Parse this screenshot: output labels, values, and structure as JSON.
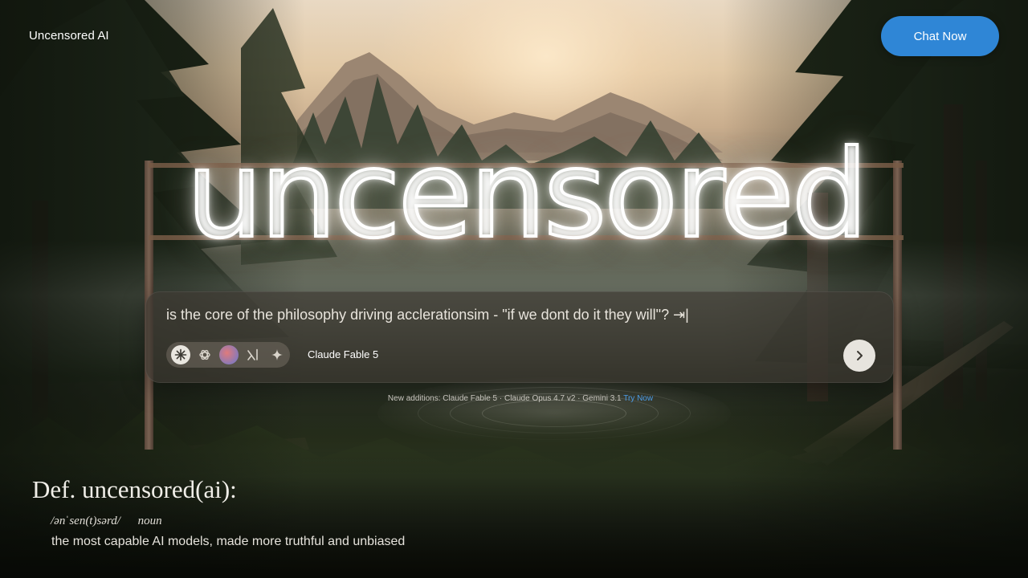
{
  "header": {
    "brand": "Uncensored AI",
    "cta_label": "Chat Now"
  },
  "hero": {
    "sign_text": "uncensored"
  },
  "prompt": {
    "text": "is the core of the philosophy driving acclerationsim - \"if we dont do it they will\"? ⇥|",
    "selected_model": "Claude Fable 5",
    "model_icons": [
      "claude-icon",
      "openai-icon",
      "gemini-avatar-icon",
      "grok-icon",
      "sparkle-icon"
    ],
    "send_icon": "chevron-right-icon"
  },
  "additions": {
    "label": "New additions:",
    "items": "Claude Fable 5 · Claude Opus 4.7 v2 · Gemini 3.1",
    "link": "Try Now"
  },
  "definition": {
    "title": "Def. uncensored(ai):",
    "phonetic": "/ənˈsen(t)sərd/",
    "part_of_speech": "noun",
    "meaning": "the most capable AI models, made more truthful and unbiased"
  },
  "colors": {
    "cta": "#2f86d6",
    "link": "#4c9be6",
    "neon": "#ffffff"
  }
}
